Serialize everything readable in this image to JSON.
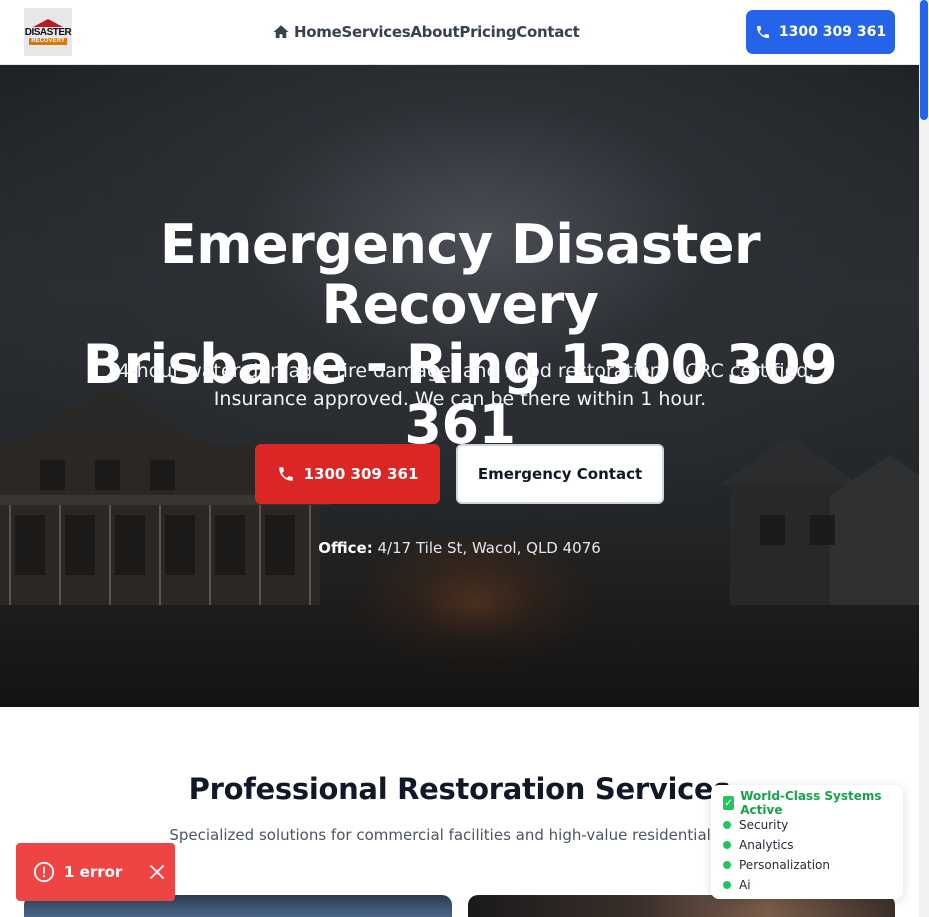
{
  "header": {
    "logo_top": "DISASTER",
    "logo_bottom": "RECOVERY",
    "nav": [
      "Home",
      "Services",
      "About",
      "Pricing",
      "Contact"
    ],
    "call_label": "1300 309 361"
  },
  "hero": {
    "title_line1": "Emergency Disaster Recovery",
    "title_line2": "Brisbane - Ring 1300 309 361",
    "sub_line1": "24-hour water damage, fire damage, and flood restoration. IICRC certified.",
    "sub_line2": "Insurance approved. We can be there within 1 hour.",
    "primary_button": "1300 309 361",
    "secondary_button": "Emergency Contact",
    "office_label": "Office:",
    "office_address": "4/17 Tile St, Wacol, QLD 4076"
  },
  "services": {
    "title": "Professional Restoration Services",
    "subtitle": "Specialized solutions for commercial facilities and high-value residential prop"
  },
  "status_widget": {
    "title": "World-Class Systems Active",
    "items": [
      "Security",
      "Analytics",
      "Personalization",
      "Ai"
    ]
  },
  "error_toast": {
    "label": "1 error"
  },
  "colors": {
    "primary": "#2563eb",
    "danger": "#dc2626",
    "success": "#22c55e",
    "toast": "#ef4444"
  }
}
